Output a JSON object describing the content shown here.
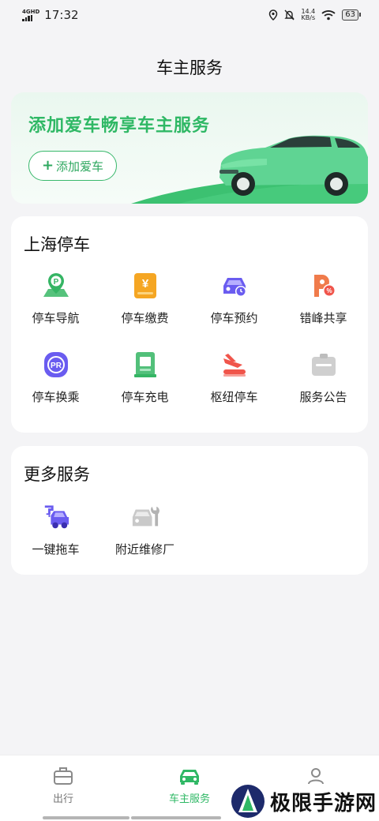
{
  "status_bar": {
    "time": "17:32",
    "network": "4GHD",
    "speed_value": "14.4",
    "speed_unit": "KB/s",
    "battery": "63"
  },
  "header": {
    "title": "车主服务"
  },
  "banner": {
    "title": "添加爱车畅享车主服务",
    "button_icon": "+",
    "button_label": "添加爱车"
  },
  "parking": {
    "title": "上海停车",
    "items": [
      {
        "label": "停车导航",
        "icon": "parking-navigation-icon"
      },
      {
        "label": "停车缴费",
        "icon": "parking-payment-icon"
      },
      {
        "label": "停车预约",
        "icon": "parking-reservation-icon"
      },
      {
        "label": "错峰共享",
        "icon": "off-peak-sharing-icon"
      },
      {
        "label": "停车换乘",
        "icon": "park-and-ride-icon"
      },
      {
        "label": "停车充电",
        "icon": "ev-charging-icon"
      },
      {
        "label": "枢纽停车",
        "icon": "hub-parking-icon"
      },
      {
        "label": "服务公告",
        "icon": "service-notice-icon"
      }
    ]
  },
  "more": {
    "title": "更多服务",
    "items": [
      {
        "label": "一键拖车",
        "icon": "tow-truck-icon"
      },
      {
        "label": "附近维修厂",
        "icon": "repair-shop-icon"
      }
    ]
  },
  "tabbar": {
    "tabs": [
      {
        "label": "出行",
        "icon": "luggage-icon",
        "active": false
      },
      {
        "label": "车主服务",
        "icon": "car-icon",
        "active": true
      },
      {
        "label": "",
        "icon": "profile-icon",
        "active": false
      }
    ]
  },
  "watermark": {
    "text": "极限手游网"
  },
  "colors": {
    "accent": "#2fb865",
    "purple": "#6a5cf0",
    "orange": "#f5a623",
    "red": "#f0554b",
    "gray": "#c9c9c9"
  }
}
